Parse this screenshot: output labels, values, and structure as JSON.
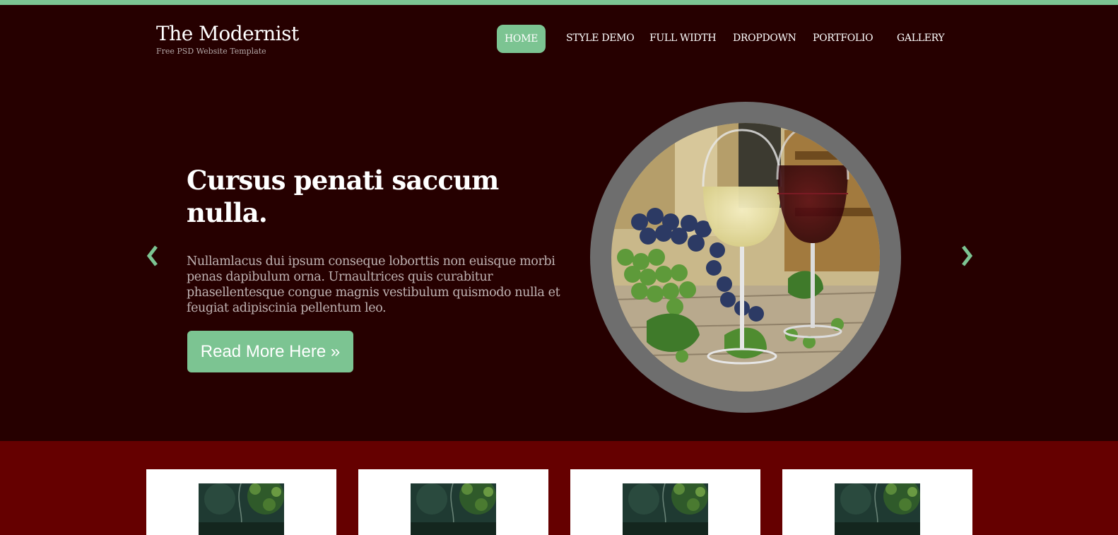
{
  "site": {
    "title": "The Modernist",
    "tagline": "Free PSD Website Template"
  },
  "nav": {
    "items": [
      "HOME",
      "STYLE DEMO",
      "FULL WIDTH",
      "DROPDOWN",
      "PORTFOLIO",
      "GALLERY"
    ],
    "active": "HOME"
  },
  "slider": {
    "title": "Cursus penati saccum nulla.",
    "text": "Nullamlacus dui ipsum conseque loborttis non euisque morbi penas dapibulum orna. Urnaultrices quis curabitur phasellentesque congue magnis vestibulum quismodo nulla et feugiat adipiscinia pellentum leo.",
    "button_label": "Read More Here »",
    "prev_icon": "chevron-left-icon",
    "next_icon": "chevron-right-icon",
    "image": "wine-glasses-grapes-photo"
  },
  "features": {
    "cards": [
      {
        "image": "forest-thumbnail"
      },
      {
        "image": "forest-thumbnail"
      },
      {
        "image": "forest-thumbnail"
      },
      {
        "image": "forest-thumbnail"
      }
    ]
  },
  "colors": {
    "accent": "#7cc492",
    "header_bg": "#260000",
    "features_bg": "#650000",
    "frame": "#6e6e6e"
  }
}
